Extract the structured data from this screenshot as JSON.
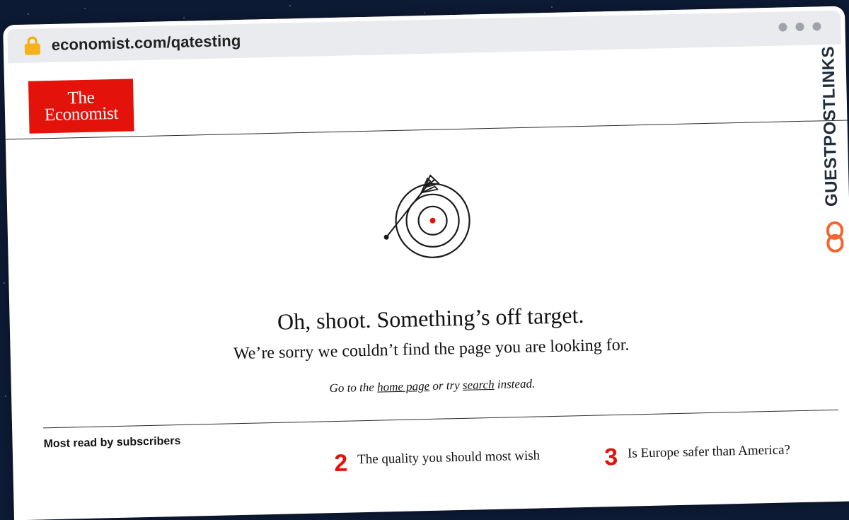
{
  "browser": {
    "url": "economist.com/qatesting"
  },
  "logo": {
    "line1": "The",
    "line2": "Economist"
  },
  "error": {
    "headline": "Oh, shoot. Something’s off target.",
    "subhead": "We’re sorry we couldn’t find the page you are looking for.",
    "hint_prefix": "Go to the ",
    "home_link": "home page",
    "hint_middle": " or try ",
    "search_link": "search",
    "hint_suffix": " instead."
  },
  "most_read": {
    "title": "Most read by subscribers",
    "items": [
      {
        "number": "2",
        "text": "The quality you should most wish"
      },
      {
        "number": "3",
        "text": "Is Europe safer than America?"
      }
    ]
  },
  "watermark": {
    "text": "GUESTPOSTLINKS"
  },
  "colors": {
    "brand_red": "#e3120b",
    "lock": "#f6b21a",
    "watermark_accent": "#f2652f"
  }
}
